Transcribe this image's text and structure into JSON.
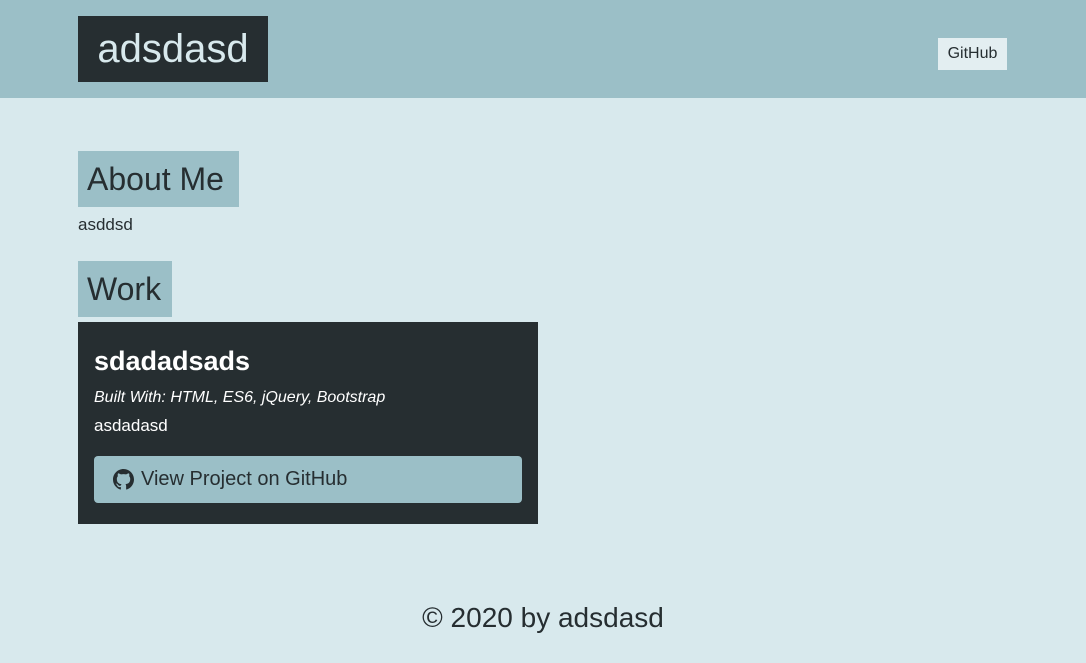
{
  "header": {
    "brand": "adsdasd",
    "nav_link": "GitHub"
  },
  "about": {
    "heading": "About Me",
    "text": "asddsd"
  },
  "work": {
    "heading": "Work",
    "project": {
      "title": "sdadadsads",
      "built_with": "Built With: HTML, ES6, jQuery, Bootstrap",
      "description": "asdadasd",
      "button_label": "View Project on GitHub",
      "button_icon": "github-icon"
    }
  },
  "footer": {
    "text": "© 2020 by adsdasd"
  },
  "colors": {
    "page_bg": "#d8e9ed",
    "header_bg": "#9bbfc7",
    "dark": "#262e31",
    "accent": "#9bbfc7"
  }
}
